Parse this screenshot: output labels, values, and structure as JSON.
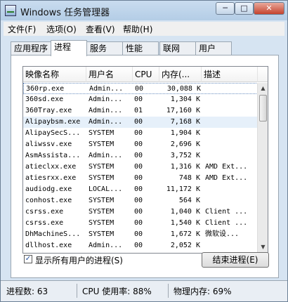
{
  "window": {
    "title": "Windows 任务管理器",
    "minimize_label": "─",
    "maximize_label": "□",
    "close_label": "✕"
  },
  "menu": [
    "文件(F)",
    "选项(O)",
    "查看(V)",
    "帮助(H)"
  ],
  "tabs": [
    {
      "label": "应用程序",
      "active": false
    },
    {
      "label": "进程",
      "active": true
    },
    {
      "label": "服务",
      "active": false
    },
    {
      "label": "性能",
      "active": false
    },
    {
      "label": "联网",
      "active": false
    },
    {
      "label": "用户",
      "active": false
    }
  ],
  "table": {
    "columns": [
      "映像名称",
      "用户名",
      "CPU",
      "内存(...",
      "描述"
    ],
    "rows": [
      {
        "name": "360rp.exe",
        "user": "Admin...",
        "cpu": "00",
        "mem": "30,088 K",
        "desc": ""
      },
      {
        "name": "360sd.exe",
        "user": "Admin...",
        "cpu": "00",
        "mem": "1,304 K",
        "desc": ""
      },
      {
        "name": "360Tray.exe",
        "user": "Admin...",
        "cpu": "01",
        "mem": "17,160 K",
        "desc": ""
      },
      {
        "name": "Alipaybsm.exe",
        "user": "Admin...",
        "cpu": "00",
        "mem": "7,168 K",
        "desc": ""
      },
      {
        "name": "AlipaySecS...",
        "user": "SYSTEM",
        "cpu": "00",
        "mem": "1,904 K",
        "desc": ""
      },
      {
        "name": "aliwssv.exe",
        "user": "SYSTEM",
        "cpu": "00",
        "mem": "2,696 K",
        "desc": ""
      },
      {
        "name": "AsmAssista...",
        "user": "Admin...",
        "cpu": "00",
        "mem": "3,752 K",
        "desc": ""
      },
      {
        "name": "atieclxx.exe",
        "user": "SYSTEM",
        "cpu": "00",
        "mem": "1,316 K",
        "desc": "AMD Ext..."
      },
      {
        "name": "atiesrxx.exe",
        "user": "SYSTEM",
        "cpu": "00",
        "mem": "748 K",
        "desc": "AMD Ext..."
      },
      {
        "name": "audiodg.exe",
        "user": "LOCAL...",
        "cpu": "00",
        "mem": "11,172 K",
        "desc": ""
      },
      {
        "name": "conhost.exe",
        "user": "SYSTEM",
        "cpu": "00",
        "mem": "564 K",
        "desc": ""
      },
      {
        "name": "csrss.exe",
        "user": "SYSTEM",
        "cpu": "00",
        "mem": "1,040 K",
        "desc": "Client ..."
      },
      {
        "name": "csrss.exe",
        "user": "SYSTEM",
        "cpu": "00",
        "mem": "1,540 K",
        "desc": "Client ..."
      },
      {
        "name": "DhMachineS...",
        "user": "SYSTEM",
        "cpu": "00",
        "mem": "1,672 K",
        "desc": "微软设..."
      },
      {
        "name": "dllhost.exe",
        "user": "Admin...",
        "cpu": "00",
        "mem": "2,052 K",
        "desc": ""
      }
    ]
  },
  "checkbox": {
    "label": "显示所有用户的进程(S)",
    "checked": true,
    "mark": "✓"
  },
  "end_process_label": "结束进程(E)",
  "status": {
    "processes": "进程数: 63",
    "cpu": "CPU 使用率: 88%",
    "memory": "物理内存: 69%"
  }
}
